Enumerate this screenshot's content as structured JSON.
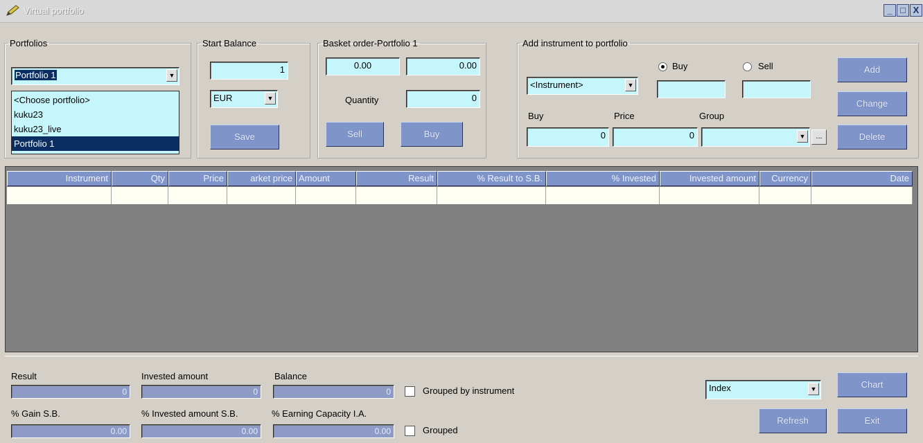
{
  "window": {
    "title": "Virtual portfolio",
    "buttons": [
      "_",
      "□",
      "X"
    ]
  },
  "portfolios": {
    "legend": "Portfolios",
    "selected": "Portfolio 1",
    "options": [
      "<Choose portfolio>",
      "kuku23",
      "kuku23_live",
      "Portfolio 1"
    ]
  },
  "start_balance": {
    "legend": "Start Balance",
    "value": "1",
    "currency": "EUR",
    "save_label": "Save"
  },
  "basket": {
    "legend": "Basket order-Portfolio 1",
    "field1": "0.00",
    "field2": "0.00",
    "quantity_label": "Quantity",
    "quantity": "0",
    "sell_label": "Sell",
    "buy_label": "Buy"
  },
  "add_instrument": {
    "legend": "Add instrument to portfolio",
    "instrument": "<Instrument>",
    "radio_buy": "Buy",
    "radio_sell": "Sell",
    "radio_selected": "Buy",
    "buy_field": "",
    "sell_field": "",
    "buy_label": "Buy",
    "price_label": "Price",
    "group_label": "Group",
    "buy_value": "0",
    "price_value": "0",
    "group_value": "",
    "dots": "...",
    "add_label": "Add",
    "change_label": "Change",
    "delete_label": "Delete"
  },
  "table": {
    "columns": [
      "Instrument",
      "Qty",
      "Price",
      "arket price",
      "Amount",
      "Result",
      "% Result to S.B.",
      "% Invested",
      "Invested amount",
      "Currency",
      "Date"
    ],
    "rows": [
      [
        "",
        "",
        "",
        "",
        "",
        "",
        "",
        "",
        "",
        "",
        ""
      ]
    ]
  },
  "summary": {
    "result_label": "Result",
    "result": "0",
    "invested_label": "Invested amount",
    "invested": "0",
    "balance_label": "Balance",
    "balance": "0",
    "gain_label": "% Gain S.B.",
    "gain": "0.00",
    "invested_sb_label": "% Invested amount S.B.",
    "invested_sb": "0.00",
    "earning_label": "% Earning Capacity I.A.",
    "earning": "0.00",
    "grouped_by_instrument": "Grouped by instrument",
    "grouped": "Grouped",
    "index_select": "Index",
    "chart_label": "Chart",
    "refresh_label": "Refresh",
    "exit_label": "Exit"
  },
  "colors": {
    "field_bg": "#c5f6fb",
    "button_bg": "#7f94c8",
    "selection": "#0b2e62",
    "grid_bg": "#808080"
  }
}
